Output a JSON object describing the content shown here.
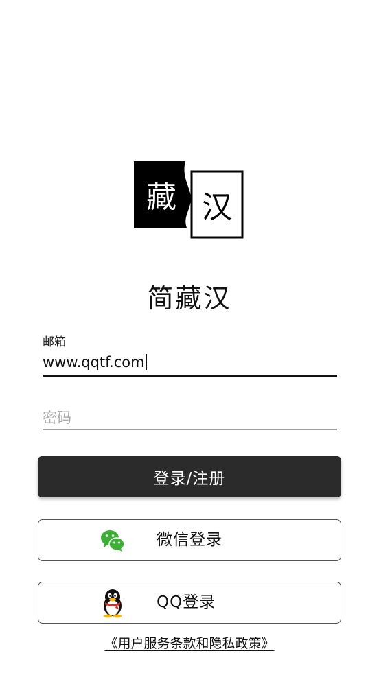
{
  "logo": {
    "char_left": "藏",
    "char_right": "汉"
  },
  "app_name": "简藏汉",
  "email": {
    "label": "邮箱",
    "value": "www.qqtf.com"
  },
  "password": {
    "placeholder": "密码"
  },
  "login_button": {
    "label": "登录/注册"
  },
  "wechat_button": {
    "label": "微信登录",
    "icon": "wechat-icon"
  },
  "qq_button": {
    "label": "QQ登录",
    "icon": "qq-penguin-icon"
  },
  "policy": {
    "label": "《用户服务条款和隐私政策》"
  },
  "colors": {
    "primary_button": "#2b2b2b",
    "wechat_green": "#3cb034",
    "text": "#111111"
  }
}
